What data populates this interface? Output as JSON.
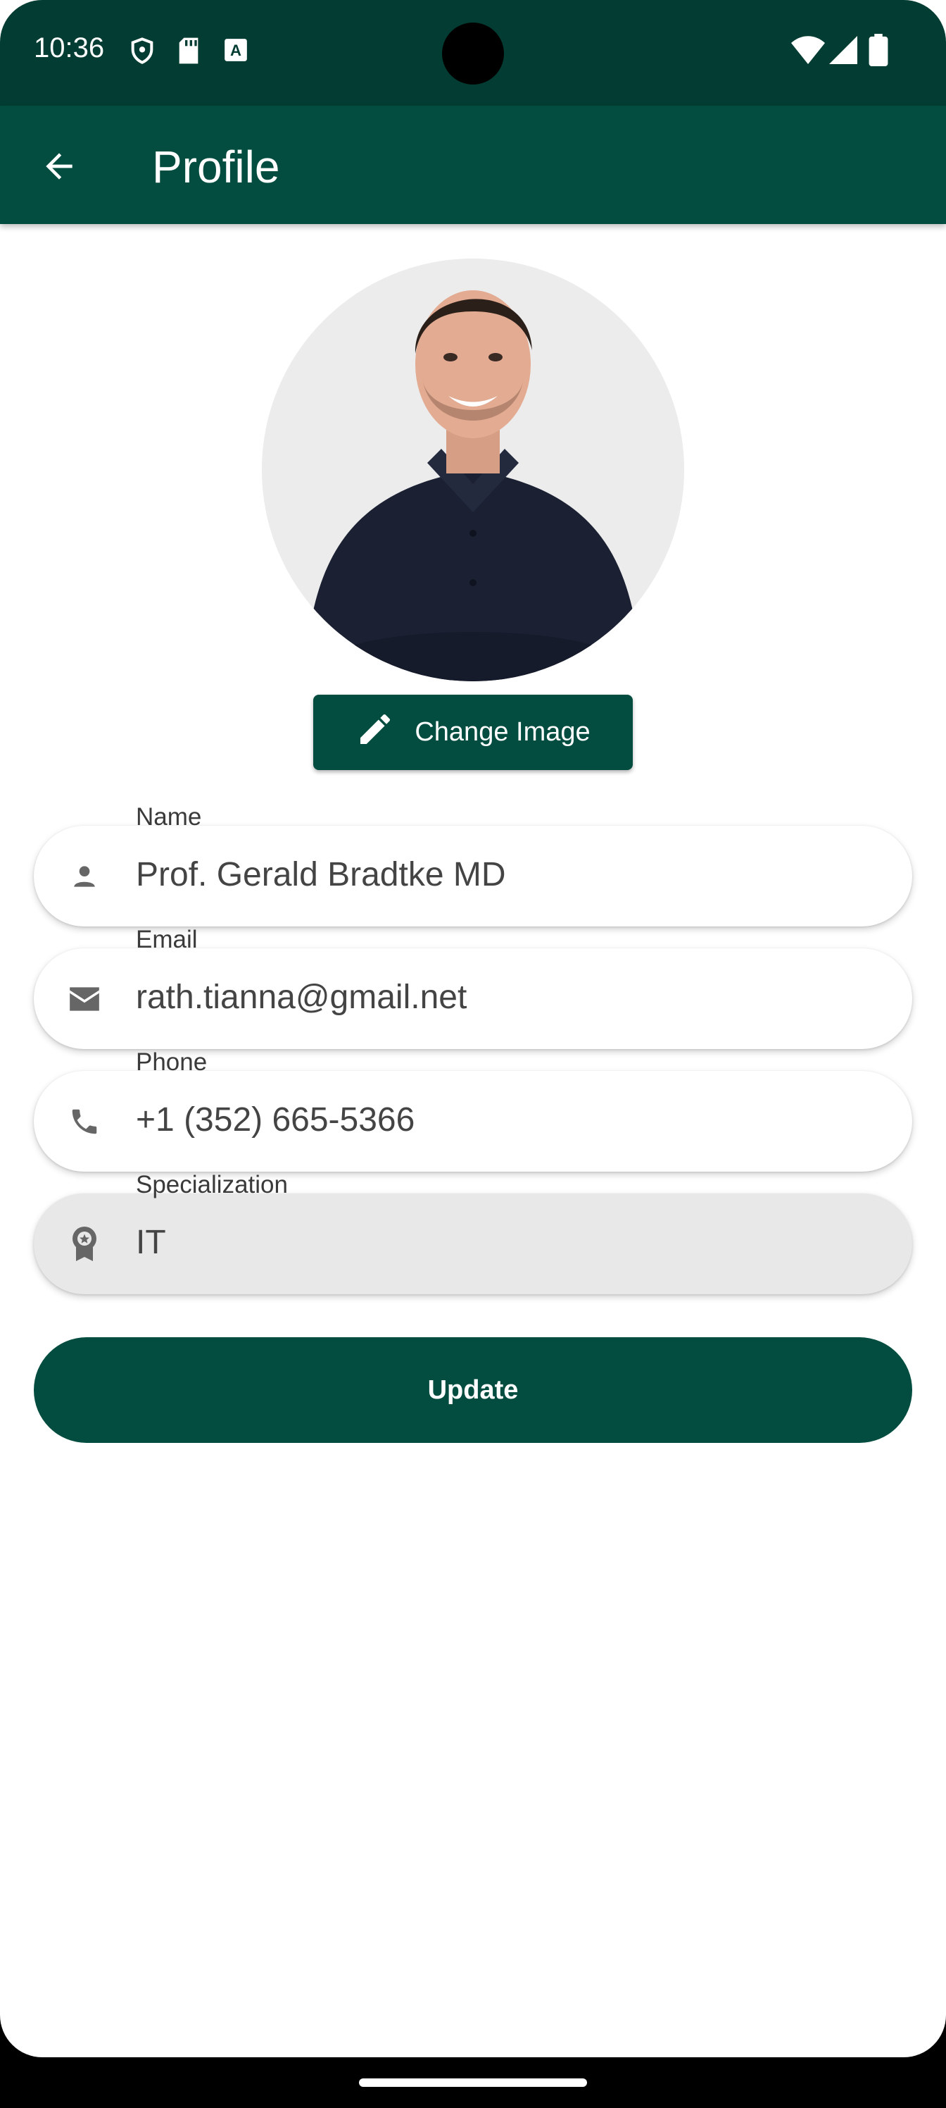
{
  "status_bar": {
    "time": "10:36",
    "icons_left": [
      "shield-icon",
      "sd-card-icon",
      "keyboard-a-icon"
    ],
    "icons_right": [
      "wifi-icon",
      "signal-icon",
      "battery-icon"
    ]
  },
  "app_bar": {
    "title": "Profile",
    "back_icon": "arrow-back-icon"
  },
  "profile": {
    "avatar_alt": "profile photo",
    "change_image_label": "Change Image"
  },
  "fields": [
    {
      "label": "Name",
      "value": "Prof. Gerald Bradtke MD",
      "icon": "person-icon"
    },
    {
      "label": "Email",
      "value": "rath.tianna@gmail.net",
      "icon": "mail-icon"
    },
    {
      "label": "Phone",
      "value": "+1 (352) 665-5366",
      "icon": "phone-icon"
    },
    {
      "label": "Specialization",
      "value": "IT",
      "icon": "award-icon",
      "disabled": true
    }
  ],
  "update_label": "Update",
  "colors": {
    "primary": "#034d40",
    "status_bar": "#033c32",
    "disabled_field": "#e8e8e8"
  }
}
